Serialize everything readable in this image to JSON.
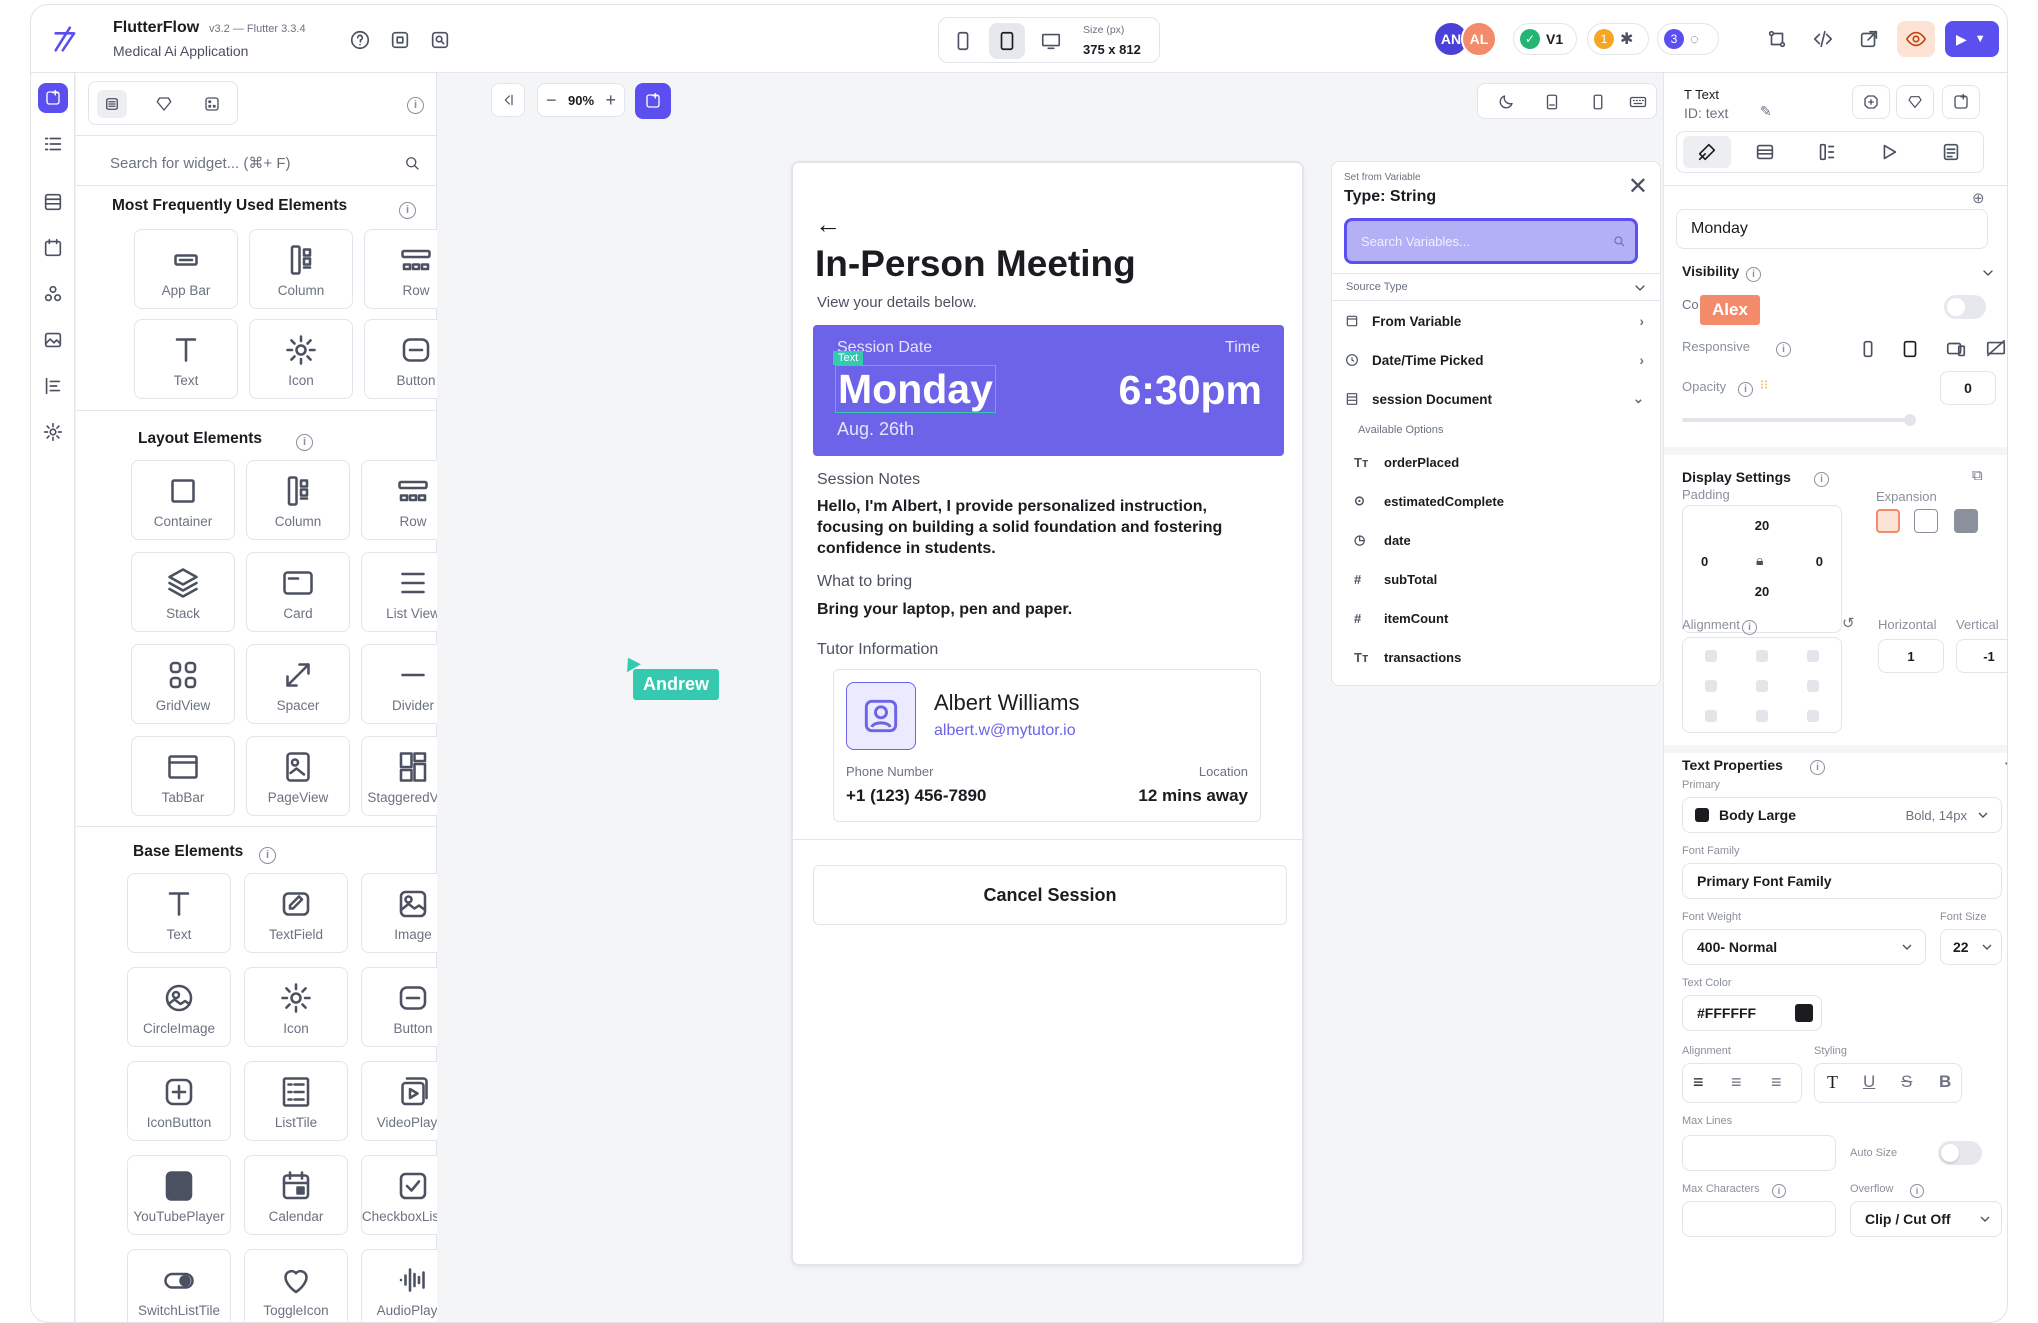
{
  "app": {
    "name": "FlutterFlow",
    "version": "v3.2 — Flutter 3.3.4",
    "project": "Medical Ai Application"
  },
  "device": {
    "size_label": "Size (px)",
    "size_value": "375 x 812",
    "zoom": "90%"
  },
  "collaborators": {
    "an": "AN",
    "al": "AL",
    "version_badge": "V1",
    "bug_count": "1",
    "comment_count": "3"
  },
  "left_panel": {
    "search_placeholder": "Search for widget... (⌘+ F)",
    "sections": {
      "frequent": "Most Frequently Used Elements",
      "layout": "Layout Elements",
      "base": "Base Elements"
    },
    "frequent_items": [
      "App Bar",
      "Column",
      "Row",
      "Text",
      "Icon",
      "Button"
    ],
    "layout_items": [
      "Container",
      "Column",
      "Row",
      "Stack",
      "Card",
      "List View",
      "GridView",
      "Spacer",
      "Divider",
      "TabBar",
      "PageView",
      "StaggeredView"
    ],
    "base_items": [
      "Text",
      "TextField",
      "Image",
      "CircleImage",
      "Icon",
      "Button",
      "IconButton",
      "ListTile",
      "VideoPlayer",
      "YouTubePlayer",
      "Calendar",
      "CheckboxListTile",
      "SwitchListTile",
      "ToggleIcon",
      "AudioPlayer"
    ]
  },
  "cursors": {
    "andrew": "Andrew",
    "alex": "Alex"
  },
  "phone": {
    "title": "In-Person Meeting",
    "subtitle": "View your details below.",
    "session_date_label": "Session Date",
    "time_label": "Time",
    "selected_tag": "Text",
    "day": "Monday",
    "time": "6:30pm",
    "date": "Aug. 26th",
    "notes_label": "Session Notes",
    "notes": "Hello, I'm Albert, I provide personalized instruction, focusing on building a solid foundation and fostering confidence in students.",
    "bring_label": "What to bring",
    "bring": "Bring your laptop, pen and paper.",
    "tutor_label": "Tutor Information",
    "tutor_name": "Albert Williams",
    "tutor_email": "albert.w@mytutor.io",
    "phone_label": "Phone Number",
    "phone_value": "+1 (123) 456-7890",
    "location_label": "Location",
    "location_value": "12 mins away",
    "cancel": "Cancel Session"
  },
  "variables": {
    "header_small": "Set from Variable",
    "type": "Type: String",
    "search_placeholder": "Search Variables...",
    "source_type": "Source Type",
    "sources": [
      "From Variable",
      "Date/Time Picked",
      "session Document"
    ],
    "available": "Available Options",
    "options": [
      "orderPlaced",
      "estimatedComplete",
      "date",
      "subTotal",
      "itemCount",
      "transactions"
    ]
  },
  "right_panel": {
    "widget_type": "Text",
    "widget_id": "ID: text",
    "value": "Monday",
    "visibility": "Visibility",
    "co": "Co",
    "responsive": "Responsive",
    "opacity": "Opacity",
    "opacity_value": "0",
    "display_settings": "Display Settings",
    "padding": "Padding",
    "expansion": "Expansion",
    "pad_top": "20",
    "pad_left": "0",
    "pad_right": "0",
    "pad_bottom": "20",
    "alignment": "Alignment",
    "horizontal": "Horizontal",
    "vertical": "Vertical",
    "h_value": "1",
    "v_value": "-1",
    "text_properties": "Text Properties",
    "primary": "Primary",
    "style_name": "Body Large",
    "style_meta": "Bold, 14px",
    "font_family_label": "Font Family",
    "font_family": "Primary Font Family",
    "font_weight_label": "Font Weight",
    "font_weight": "400- Normal",
    "font_size_label": "Font Size",
    "font_size": "22",
    "text_color_label": "Text Color",
    "text_color": "#FFFFFF",
    "alignment2": "Alignment",
    "styling": "Styling",
    "max_lines": "Max Lines",
    "auto_size": "Auto Size",
    "max_chars": "Max Characters",
    "overflow": "Overflow",
    "overflow_value": "Clip / Cut Off"
  },
  "colors": {
    "accent": "#6c63e8",
    "cursor_andrew": "#35c9b0",
    "cursor_alex": "#f38b6a",
    "run": "#5b4ff0"
  }
}
